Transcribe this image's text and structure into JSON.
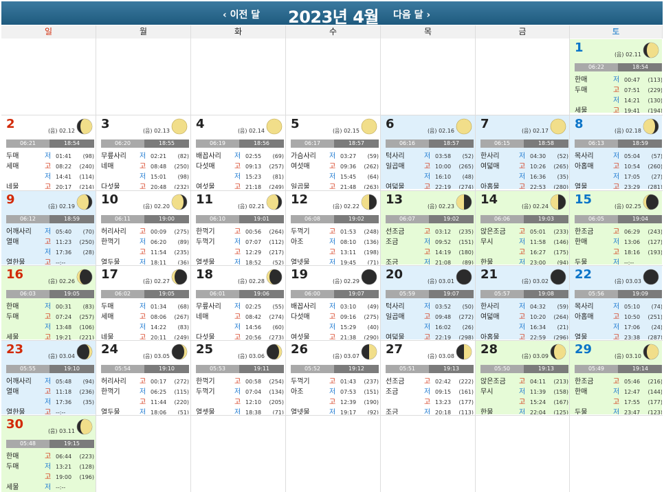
{
  "header": {
    "prev_label": "‹ 이전 달",
    "title": "2023년 4월",
    "next_label": "다음 달 ›"
  },
  "weekdays": [
    "일",
    "월",
    "화",
    "수",
    "목",
    "금",
    "토"
  ],
  "colors": {
    "sunday": "#d22a08",
    "saturday": "#0b74c8",
    "saturday_bg": "#dff0fb",
    "green_bg": "#e6fbd7",
    "low_tide": "#1b78d0",
    "high_tide": "#d22a08"
  },
  "days": [
    {
      "day": "1",
      "col": 6,
      "row": 0,
      "bg": "grn",
      "color": "sat",
      "lunar": "(음) 02.11",
      "moon": "waxing-gibbous",
      "rise": "06:22",
      "set": "18:54",
      "tides": [
        [
          "한매",
          "저",
          "00:47",
          "(113)"
        ],
        [
          "두매",
          "고",
          "07:51",
          "(229)"
        ],
        [
          "",
          "저",
          "14:21",
          "(130)"
        ],
        [
          "세물",
          "고",
          "19:41",
          "(194)"
        ]
      ]
    },
    {
      "day": "2",
      "col": 0,
      "row": 1,
      "bg": "",
      "color": "sun",
      "lunar": "(음) 02.12",
      "moon": "waxing-gibbous",
      "rise": "06:21",
      "set": "18:54",
      "tides": [
        [
          "두매",
          "저",
          "01:41",
          "(98)"
        ],
        [
          "세매",
          "고",
          "08:22",
          "(240)"
        ],
        [
          "",
          "저",
          "14:41",
          "(114)"
        ],
        [
          "네물",
          "고",
          "20:17",
          "(214)"
        ]
      ]
    },
    {
      "day": "3",
      "col": 1,
      "row": 1,
      "bg": "",
      "color": "wk",
      "lunar": "(음) 02.13",
      "moon": "full",
      "rise": "06:20",
      "set": "18:55",
      "tides": [
        [
          "무릎사리",
          "저",
          "02:21",
          "(82)"
        ],
        [
          "네매",
          "고",
          "08:48",
          "(250)"
        ],
        [
          "",
          "저",
          "15:01",
          "(98)"
        ],
        [
          "다섯물",
          "고",
          "20:48",
          "(232)"
        ]
      ]
    },
    {
      "day": "4",
      "col": 2,
      "row": 1,
      "bg": "",
      "color": "wk",
      "lunar": "(음) 02.14",
      "moon": "full",
      "rise": "06:19",
      "set": "18:56",
      "tides": [
        [
          "배꼽사리",
          "저",
          "02:55",
          "(69)"
        ],
        [
          "다섯매",
          "고",
          "09:13",
          "(257)"
        ],
        [
          "",
          "저",
          "15:23",
          "(81)"
        ],
        [
          "여섯물",
          "고",
          "21:18",
          "(249)"
        ]
      ]
    },
    {
      "day": "5",
      "col": 3,
      "row": 1,
      "bg": "",
      "color": "wk",
      "lunar": "(음) 02.15",
      "moon": "full",
      "rise": "06:17",
      "set": "18:57",
      "tides": [
        [
          "가슴사리",
          "저",
          "03:27",
          "(59)"
        ],
        [
          "여섯매",
          "고",
          "09:36",
          "(262)"
        ],
        [
          "",
          "저",
          "15:45",
          "(64)"
        ],
        [
          "일곱물",
          "고",
          "21:48",
          "(263)"
        ]
      ]
    },
    {
      "day": "6",
      "col": 4,
      "row": 1,
      "bg": "sat",
      "color": "wk",
      "lunar": "(음) 02.16",
      "moon": "full",
      "rise": "06:16",
      "set": "18:57",
      "tides": [
        [
          "턱사리",
          "저",
          "03:58",
          "(52)"
        ],
        [
          "일곱매",
          "고",
          "10:00",
          "(265)"
        ],
        [
          "",
          "저",
          "16:10",
          "(48)"
        ],
        [
          "여덟물",
          "고",
          "22:19",
          "(274)"
        ]
      ]
    },
    {
      "day": "7",
      "col": 5,
      "row": 1,
      "bg": "sat",
      "color": "wk",
      "lunar": "(음) 02.17",
      "moon": "full",
      "rise": "06:15",
      "set": "18:58",
      "tides": [
        [
          "한사리",
          "저",
          "04:30",
          "(52)"
        ],
        [
          "여덟매",
          "고",
          "10:26",
          "(265)"
        ],
        [
          "",
          "저",
          "16:36",
          "(35)"
        ],
        [
          "아홉물",
          "고",
          "22:53",
          "(280)"
        ]
      ]
    },
    {
      "day": "8",
      "col": 6,
      "row": 1,
      "bg": "sat",
      "color": "sat",
      "lunar": "(음) 02.18",
      "moon": "waning-gibbous",
      "rise": "06:13",
      "set": "18:59",
      "tides": [
        [
          "목사리",
          "저",
          "05:04",
          "(57)"
        ],
        [
          "아홉매",
          "고",
          "10:54",
          "(260)"
        ],
        [
          "",
          "저",
          "17:05",
          "(27)"
        ],
        [
          "열물",
          "고",
          "23:29",
          "(281)"
        ]
      ]
    },
    {
      "day": "9",
      "col": 0,
      "row": 2,
      "bg": "sat",
      "color": "sun",
      "lunar": "(음) 02.19",
      "moon": "waning-gibbous",
      "rise": "06:12",
      "set": "18:59",
      "tides": [
        [
          "어깨사리",
          "저",
          "05:40",
          "(70)"
        ],
        [
          "열매",
          "고",
          "11:23",
          "(250)"
        ],
        [
          "",
          "저",
          "17:36",
          "(28)"
        ],
        [
          "열한물",
          "고",
          "--:--",
          ""
        ]
      ]
    },
    {
      "day": "10",
      "col": 1,
      "row": 2,
      "bg": "",
      "color": "wk",
      "lunar": "(음) 02.20",
      "moon": "waning-gibbous",
      "rise": "06:11",
      "set": "19:00",
      "tides": [
        [
          "허리사리",
          "고",
          "00:09",
          "(275)"
        ],
        [
          "한꺽기",
          "저",
          "06:20",
          "(89)"
        ],
        [
          "",
          "고",
          "11:54",
          "(235)"
        ],
        [
          "열두물",
          "저",
          "18:11",
          "(36)"
        ]
      ]
    },
    {
      "day": "11",
      "col": 2,
      "row": 2,
      "bg": "",
      "color": "wk",
      "lunar": "(음) 02.21",
      "moon": "waning-gibbous",
      "rise": "06:10",
      "set": "19:01",
      "tides": [
        [
          "한꺽기",
          "고",
          "00:56",
          "(264)"
        ],
        [
          "두꺽기",
          "저",
          "07:07",
          "(112)"
        ],
        [
          "",
          "고",
          "12:29",
          "(217)"
        ],
        [
          "열셋물",
          "저",
          "18:52",
          "(52)"
        ]
      ]
    },
    {
      "day": "12",
      "col": 3,
      "row": 2,
      "bg": "",
      "color": "wk",
      "lunar": "(음) 02.22",
      "moon": "last-quarter",
      "rise": "06:08",
      "set": "19:02",
      "tides": [
        [
          "두꺽기",
          "고",
          "01:53",
          "(248)"
        ],
        [
          "아조",
          "저",
          "08:10",
          "(136)"
        ],
        [
          "",
          "고",
          "13:11",
          "(198)"
        ],
        [
          "열넷물",
          "저",
          "19:45",
          "(71)"
        ]
      ]
    },
    {
      "day": "13",
      "col": 4,
      "row": 2,
      "bg": "grn",
      "color": "wk",
      "lunar": "(음) 02.23",
      "moon": "last-quarter",
      "rise": "06:07",
      "set": "19:02",
      "tides": [
        [
          "선조금",
          "고",
          "03:12",
          "(235)"
        ],
        [
          "조금",
          "저",
          "09:52",
          "(151)"
        ],
        [
          "",
          "고",
          "14:19",
          "(180)"
        ],
        [
          "조금",
          "저",
          "21:08",
          "(89)"
        ]
      ]
    },
    {
      "day": "14",
      "col": 5,
      "row": 2,
      "bg": "grn",
      "color": "wk",
      "lunar": "(음) 02.24",
      "moon": "last-quarter",
      "rise": "06:06",
      "set": "19:03",
      "tides": [
        [
          "앉은조금",
          "고",
          "05:01",
          "(233)"
        ],
        [
          "무시",
          "저",
          "11:58",
          "(146)"
        ],
        [
          "",
          "고",
          "16:27",
          "(175)"
        ],
        [
          "한물",
          "저",
          "23:00",
          "(94)"
        ]
      ]
    },
    {
      "day": "15",
      "col": 6,
      "row": 2,
      "bg": "grn",
      "color": "sat",
      "lunar": "(음) 02.25",
      "moon": "waning-crescent",
      "rise": "06:05",
      "set": "19:04",
      "tides": [
        [
          "한조금",
          "고",
          "06:29",
          "(243)"
        ],
        [
          "한매",
          "저",
          "13:06",
          "(127)"
        ],
        [
          "",
          "고",
          "18:16",
          "(193)"
        ],
        [
          "두물",
          "저",
          "--:--",
          ""
        ]
      ]
    },
    {
      "day": "16",
      "col": 0,
      "row": 3,
      "bg": "grn",
      "color": "sun",
      "lunar": "(음) 02.26",
      "moon": "waning-crescent",
      "rise": "06:03",
      "set": "19:05",
      "tides": [
        [
          "한매",
          "저",
          "00:31",
          "(83)"
        ],
        [
          "두매",
          "고",
          "07:24",
          "(257)"
        ],
        [
          "",
          "저",
          "13:48",
          "(106)"
        ],
        [
          "세물",
          "고",
          "19:21",
          "(221)"
        ]
      ]
    },
    {
      "day": "17",
      "col": 1,
      "row": 3,
      "bg": "",
      "color": "wk",
      "lunar": "(음) 02.27",
      "moon": "waning-crescent",
      "rise": "06:02",
      "set": "19:05",
      "tides": [
        [
          "두매",
          "저",
          "01:34",
          "(68)"
        ],
        [
          "세매",
          "고",
          "08:06",
          "(267)"
        ],
        [
          "",
          "저",
          "14:22",
          "(83)"
        ],
        [
          "네물",
          "고",
          "20:11",
          "(249)"
        ]
      ]
    },
    {
      "day": "18",
      "col": 2,
      "row": 3,
      "bg": "",
      "color": "wk",
      "lunar": "(음) 02.28",
      "moon": "waning-crescent",
      "rise": "06:01",
      "set": "19:06",
      "tides": [
        [
          "무릎사리",
          "저",
          "02:25",
          "(55)"
        ],
        [
          "네매",
          "고",
          "08:42",
          "(274)"
        ],
        [
          "",
          "저",
          "14:56",
          "(60)"
        ],
        [
          "다섯물",
          "고",
          "20:56",
          "(273)"
        ]
      ]
    },
    {
      "day": "19",
      "col": 3,
      "row": 3,
      "bg": "",
      "color": "wk",
      "lunar": "(음) 02.29",
      "moon": "new",
      "rise": "06:00",
      "set": "19:07",
      "tides": [
        [
          "배꼽사리",
          "저",
          "03:10",
          "(49)"
        ],
        [
          "다섯매",
          "고",
          "09:16",
          "(275)"
        ],
        [
          "",
          "저",
          "15:29",
          "(40)"
        ],
        [
          "여섯물",
          "고",
          "21:38",
          "(290)"
        ]
      ]
    },
    {
      "day": "20",
      "col": 4,
      "row": 3,
      "bg": "sat",
      "color": "wk",
      "lunar": "(음) 03.01",
      "moon": "new",
      "rise": "05:59",
      "set": "19:07",
      "tides": [
        [
          "턱사리",
          "저",
          "03:52",
          "(50)"
        ],
        [
          "일곱매",
          "고",
          "09:48",
          "(272)"
        ],
        [
          "",
          "저",
          "16:02",
          "(26)"
        ],
        [
          "여덟물",
          "고",
          "22:19",
          "(298)"
        ]
      ]
    },
    {
      "day": "21",
      "col": 5,
      "row": 3,
      "bg": "sat",
      "color": "wk",
      "lunar": "(음) 03.02",
      "moon": "new",
      "rise": "05:57",
      "set": "19:08",
      "tides": [
        [
          "한사리",
          "저",
          "04:32",
          "(59)"
        ],
        [
          "여덟매",
          "고",
          "10:20",
          "(264)"
        ],
        [
          "",
          "저",
          "16:34",
          "(21)"
        ],
        [
          "아홉물",
          "고",
          "22:59",
          "(296)"
        ]
      ]
    },
    {
      "day": "22",
      "col": 6,
      "row": 3,
      "bg": "sat",
      "color": "sat",
      "lunar": "(음) 03.03",
      "moon": "new",
      "rise": "05:56",
      "set": "19:09",
      "tides": [
        [
          "목사리",
          "저",
          "05:10",
          "(74)"
        ],
        [
          "아홉매",
          "고",
          "10:50",
          "(251)"
        ],
        [
          "",
          "저",
          "17:06",
          "(24)"
        ],
        [
          "열물",
          "고",
          "23:38",
          "(287)"
        ]
      ]
    },
    {
      "day": "23",
      "col": 0,
      "row": 4,
      "bg": "sat",
      "color": "sun",
      "lunar": "(음) 03.04",
      "moon": "waxing-crescent",
      "rise": "05:55",
      "set": "19:10",
      "tides": [
        [
          "어깨사리",
          "저",
          "05:48",
          "(94)"
        ],
        [
          "열매",
          "고",
          "11:18",
          "(236)"
        ],
        [
          "",
          "저",
          "17:36",
          "(35)"
        ],
        [
          "열한물",
          "고",
          "--:--",
          ""
        ]
      ]
    },
    {
      "day": "24",
      "col": 1,
      "row": 4,
      "bg": "",
      "color": "wk",
      "lunar": "(음) 03.05",
      "moon": "waxing-crescent",
      "rise": "05:54",
      "set": "19:10",
      "tides": [
        [
          "허리사리",
          "고",
          "00:17",
          "(272)"
        ],
        [
          "한꺽기",
          "저",
          "06:25",
          "(115)"
        ],
        [
          "",
          "고",
          "11:44",
          "(220)"
        ],
        [
          "열두물",
          "저",
          "18:06",
          "(51)"
        ]
      ]
    },
    {
      "day": "25",
      "col": 2,
      "row": 4,
      "bg": "",
      "color": "wk",
      "lunar": "(음) 03.06",
      "moon": "waxing-crescent",
      "rise": "05:53",
      "set": "19:11",
      "tides": [
        [
          "한꺽기",
          "고",
          "00:58",
          "(254)"
        ],
        [
          "두꺽기",
          "저",
          "07:04",
          "(134)"
        ],
        [
          "",
          "고",
          "12:10",
          "(205)"
        ],
        [
          "열셋물",
          "저",
          "18:38",
          "(71)"
        ]
      ]
    },
    {
      "day": "26",
      "col": 3,
      "row": 4,
      "bg": "",
      "color": "wk",
      "lunar": "(음) 03.07",
      "moon": "first-quarter",
      "rise": "05:52",
      "set": "19:12",
      "tides": [
        [
          "두꺽기",
          "고",
          "01:43",
          "(237)"
        ],
        [
          "아조",
          "저",
          "07:53",
          "(151)"
        ],
        [
          "",
          "고",
          "12:39",
          "(190)"
        ],
        [
          "열넷물",
          "저",
          "19:17",
          "(92)"
        ]
      ]
    },
    {
      "day": "27",
      "col": 4,
      "row": 4,
      "bg": "",
      "color": "wk",
      "lunar": "(음) 03.08",
      "moon": "first-quarter",
      "rise": "05:51",
      "set": "19:13",
      "tides": [
        [
          "선조금",
          "고",
          "02:42",
          "(222)"
        ],
        [
          "조금",
          "저",
          "09:15",
          "(161)"
        ],
        [
          "",
          "고",
          "13:23",
          "(177)"
        ],
        [
          "조금",
          "저",
          "20:18",
          "(113)"
        ]
      ]
    },
    {
      "day": "28",
      "col": 5,
      "row": 4,
      "bg": "grn",
      "color": "wk",
      "lunar": "(음) 03.09",
      "moon": "waxing-gibbous",
      "rise": "05:50",
      "set": "19:13",
      "tides": [
        [
          "앉은조금",
          "고",
          "04:11",
          "(213)"
        ],
        [
          "무시",
          "저",
          "11:39",
          "(158)"
        ],
        [
          "",
          "고",
          "15:24",
          "(167)"
        ],
        [
          "한물",
          "저",
          "22:04",
          "(125)"
        ]
      ]
    },
    {
      "day": "29",
      "col": 6,
      "row": 4,
      "bg": "grn",
      "color": "sat",
      "lunar": "(음) 03.10",
      "moon": "waxing-gibbous",
      "rise": "05:49",
      "set": "19:14",
      "tides": [
        [
          "한조금",
          "고",
          "05:46",
          "(216)"
        ],
        [
          "한매",
          "저",
          "12:47",
          "(144)"
        ],
        [
          "",
          "고",
          "17:55",
          "(177)"
        ],
        [
          "두물",
          "저",
          "23:47",
          "(123)"
        ]
      ]
    },
    {
      "day": "30",
      "col": 0,
      "row": 5,
      "bg": "grn",
      "color": "sun",
      "lunar": "(음) 03.11",
      "moon": "waxing-gibbous",
      "rise": "05:48",
      "set": "19:15",
      "tides": [
        [
          "한매",
          "고",
          "06:44",
          "(223)"
        ],
        [
          "두매",
          "저",
          "13:21",
          "(128)"
        ],
        [
          "",
          "고",
          "19:00",
          "(196)"
        ],
        [
          "세물",
          "저",
          "--:--",
          ""
        ]
      ]
    }
  ]
}
